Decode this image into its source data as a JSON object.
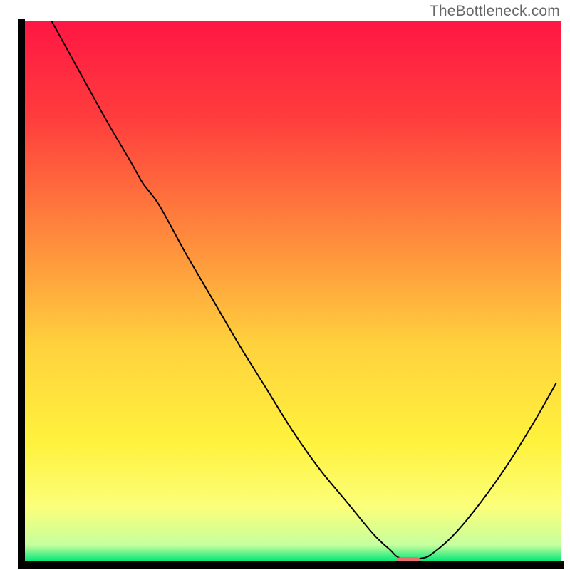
{
  "watermark": "TheBottleneck.com",
  "chart_data": {
    "type": "line",
    "title": "",
    "xlabel": "",
    "ylabel": "",
    "xlim": [
      0,
      100
    ],
    "ylim": [
      0,
      100
    ],
    "grid": false,
    "legend": false,
    "background_gradient": {
      "stops": [
        {
          "offset": 0.0,
          "color": "#ff1744"
        },
        {
          "offset": 0.18,
          "color": "#ff3d3d"
        },
        {
          "offset": 0.4,
          "color": "#ff8a3d"
        },
        {
          "offset": 0.6,
          "color": "#ffd23d"
        },
        {
          "offset": 0.78,
          "color": "#fff23d"
        },
        {
          "offset": 0.9,
          "color": "#fbff7a"
        },
        {
          "offset": 0.97,
          "color": "#c5ff9e"
        },
        {
          "offset": 1.0,
          "color": "#00e676"
        }
      ]
    },
    "marker": {
      "x": 71.5,
      "y": 0,
      "color": "#e8716e",
      "width": 4.5,
      "height": 1.3
    },
    "series": [
      {
        "name": "curve",
        "color": "#000000",
        "stroke_width": 2,
        "x": [
          5,
          10,
          15,
          20,
          22,
          25,
          30,
          35,
          40,
          45,
          50,
          55,
          60,
          65,
          68,
          70,
          74,
          76,
          80,
          85,
          90,
          95,
          99
        ],
        "y": [
          100,
          91,
          82,
          73.5,
          70,
          66,
          57,
          48.5,
          40,
          32,
          24,
          17,
          11,
          5,
          2.2,
          0.6,
          0.6,
          1.5,
          5,
          11,
          18,
          26,
          33
        ]
      }
    ]
  }
}
